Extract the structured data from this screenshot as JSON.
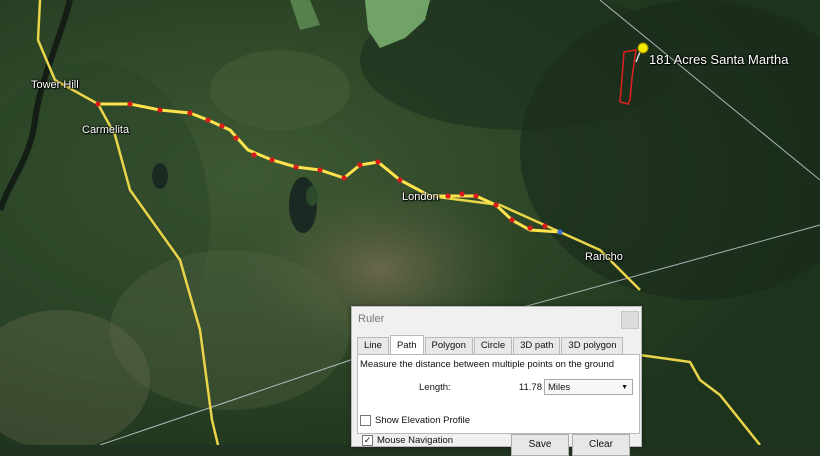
{
  "map": {
    "places": {
      "tower_hill": "Tower Hill",
      "carmelita": "Carmelita",
      "london": "London",
      "rancho": "Rancho",
      "poi": "181 Acres Santa Martha"
    },
    "colors": {
      "road": "#e9d44a",
      "path": "#ffe34d",
      "vertex": "#d81b1b",
      "parcel": "#e11f1f",
      "pin": "#f5e800",
      "water": "#1a2a22"
    }
  },
  "ruler": {
    "title": "Ruler",
    "tabs": [
      "Line",
      "Path",
      "Polygon",
      "Circle",
      "3D path",
      "3D polygon"
    ],
    "active_tab": "Path",
    "description": "Measure the distance between multiple points on the ground",
    "length_label": "Length:",
    "length_value": "11.78",
    "unit": "Miles",
    "show_elevation_label": "Show Elevation Profile",
    "mouse_nav_label": "Mouse Navigation",
    "mouse_nav_checked": true,
    "save_label": "Save",
    "clear_label": "Clear"
  }
}
